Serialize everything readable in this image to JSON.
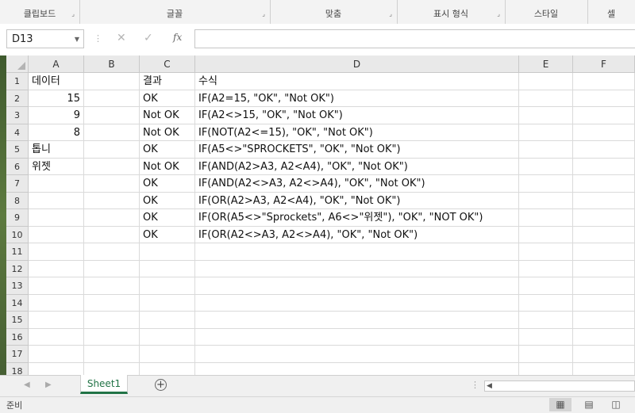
{
  "ribbon": {
    "groups": [
      {
        "label": "클립보드"
      },
      {
        "label": "글꼴"
      },
      {
        "label": "맞춤"
      },
      {
        "label": "표시 형식"
      },
      {
        "label": "스타일"
      },
      {
        "label": "셀"
      }
    ]
  },
  "formula_bar": {
    "name_box": "D13",
    "formula": "",
    "fx_label": "fx"
  },
  "columns": [
    "A",
    "B",
    "C",
    "D",
    "E",
    "F"
  ],
  "rows": [
    {
      "num": "1",
      "a": "데이터",
      "b": "",
      "c": "결과",
      "d": "수식"
    },
    {
      "num": "2",
      "a": "15",
      "b": "",
      "c": "OK",
      "d": "IF(A2=15, \"OK\", \"Not OK\")"
    },
    {
      "num": "3",
      "a": "9",
      "b": "",
      "c": "Not OK",
      "d": "IF(A2<>15, \"OK\", \"Not OK\")"
    },
    {
      "num": "4",
      "a": "8",
      "b": "",
      "c": "Not OK",
      "d": "IF(NOT(A2<=15), \"OK\", \"Not OK\")"
    },
    {
      "num": "5",
      "a": "톱니",
      "b": "",
      "c": "OK",
      "d": "IF(A5<>\"SPROCKETS\", \"OK\", \"Not OK\")"
    },
    {
      "num": "6",
      "a": "위젯",
      "b": "",
      "c": "Not OK",
      "d": "IF(AND(A2>A3, A2<A4), \"OK\", \"Not OK\")"
    },
    {
      "num": "7",
      "a": "",
      "b": "",
      "c": "OK",
      "d": "IF(AND(A2<>A3, A2<>A4), \"OK\", \"Not OK\")"
    },
    {
      "num": "8",
      "a": "",
      "b": "",
      "c": "OK",
      "d": "IF(OR(A2>A3, A2<A4), \"OK\", \"Not OK\")"
    },
    {
      "num": "9",
      "a": "",
      "b": "",
      "c": "OK",
      "d": "IF(OR(A5<>\"Sprockets\", A6<>\"위젯\"), \"OK\", \"NOT OK\")"
    },
    {
      "num": "10",
      "a": "",
      "b": "",
      "c": "OK",
      "d": "IF(OR(A2<>A3, A2<>A4), \"OK\", \"Not OK\")"
    },
    {
      "num": "11",
      "a": "",
      "b": "",
      "c": "",
      "d": ""
    },
    {
      "num": "12",
      "a": "",
      "b": "",
      "c": "",
      "d": ""
    },
    {
      "num": "13",
      "a": "",
      "b": "",
      "c": "",
      "d": ""
    },
    {
      "num": "14",
      "a": "",
      "b": "",
      "c": "",
      "d": ""
    },
    {
      "num": "15",
      "a": "",
      "b": "",
      "c": "",
      "d": ""
    },
    {
      "num": "16",
      "a": "",
      "b": "",
      "c": "",
      "d": ""
    },
    {
      "num": "17",
      "a": "",
      "b": "",
      "c": "",
      "d": ""
    },
    {
      "num": "18",
      "a": "",
      "b": "",
      "c": "",
      "d": ""
    }
  ],
  "sheet_tabs": [
    {
      "label": "Sheet1",
      "active": true
    }
  ],
  "status_bar": {
    "text": "준비"
  },
  "accent_color": "#217346"
}
